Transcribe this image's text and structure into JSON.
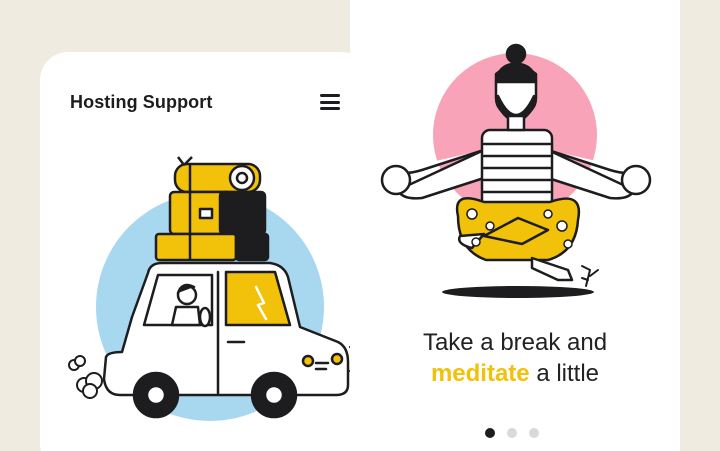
{
  "left_card": {
    "title": "Hosting Support",
    "menu_icon": "hamburger-menu-icon",
    "illustration": "car-with-luggage-illustration"
  },
  "right_card": {
    "illustration": "meditating-man-illustration",
    "headline_line1": "Take a break and",
    "headline_accent": "meditate",
    "headline_rest": " a little",
    "pagination": {
      "total": 3,
      "active_index": 0
    }
  },
  "colors": {
    "background": "#efebe0",
    "card": "#ffffff",
    "accent_yellow": "#f2c10a",
    "circle_blue": "#a8d8f0",
    "circle_pink": "#f8a3b8",
    "text_dark": "#1d1d1f",
    "dot_inactive": "#d9d9d9"
  }
}
